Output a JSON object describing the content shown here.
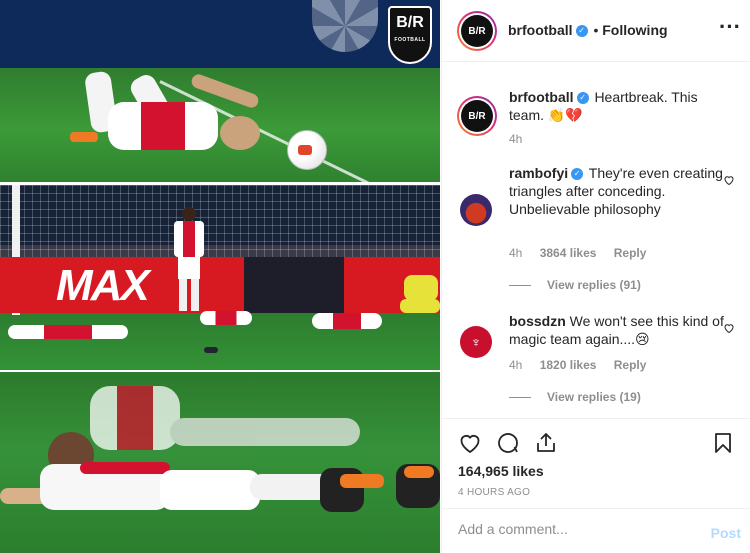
{
  "header": {
    "username": "brfootball",
    "separator": "•",
    "follow_status": "Following",
    "menu_icon": "more-options-icon",
    "avatar_text": "B/R"
  },
  "photo": {
    "logo_top": "B/R",
    "logo_bottom": "FOOTBALL",
    "ad_text": "MAX"
  },
  "caption": {
    "username": "brfootball",
    "text": "Heartbreak. This team. 👏💔",
    "time": "4h"
  },
  "comments": [
    {
      "username": "rambofyi",
      "verified": true,
      "text": "They're even creating triangles after conceding. Unbelievable philosophy",
      "time": "4h",
      "likes": "3864 likes",
      "reply_label": "Reply",
      "view_replies": "View replies (91)"
    },
    {
      "username": "bossdzn",
      "verified": false,
      "text": "We won't see this kind of magic team again....😢",
      "time": "4h",
      "likes": "1820 likes",
      "reply_label": "Reply",
      "view_replies": "View replies (19)"
    }
  ],
  "actions": {
    "like_icon": "heart-icon",
    "comment_icon": "comment-icon",
    "share_icon": "share-icon",
    "save_icon": "bookmark-icon",
    "likes_count": "164,965 likes",
    "time_ago": "4 HOURS AGO"
  },
  "add_comment": {
    "placeholder": "Add a comment...",
    "post_label": "Post"
  },
  "colors": {
    "verified": "#3897f0",
    "post_button": "#b3dbff",
    "muted_text": "#8e8e8e",
    "ajax_red": "#d2122e"
  }
}
